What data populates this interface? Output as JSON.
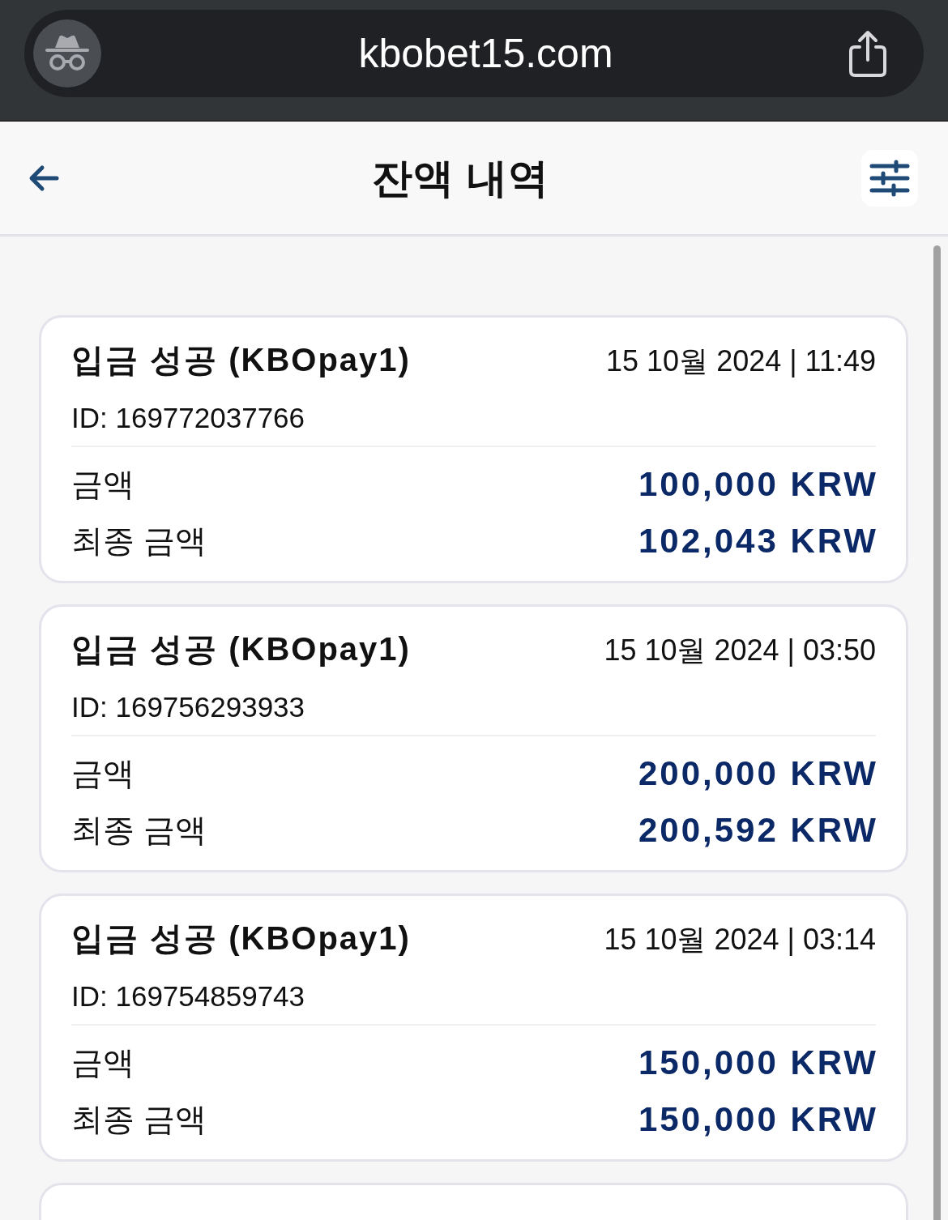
{
  "browser_bar": {
    "url": "kbobet15.com"
  },
  "header": {
    "title": "잔액 내역"
  },
  "transactions": [
    {
      "title": "입금 성공 (KBOpay1)",
      "datetime": "15 10월 2024 | 11:49",
      "id": "ID: 169772037766",
      "rows": [
        {
          "label": "금액",
          "value": "100,000 KRW"
        },
        {
          "label": "최종 금액",
          "value": "102,043 KRW"
        }
      ]
    },
    {
      "title": "입금 성공 (KBOpay1)",
      "datetime": "15 10월 2024 | 03:50",
      "id": "ID: 169756293933",
      "rows": [
        {
          "label": "금액",
          "value": "200,000 KRW"
        },
        {
          "label": "최종 금액",
          "value": "200,592 KRW"
        }
      ]
    },
    {
      "title": "입금 성공 (KBOpay1)",
      "datetime": "15 10월 2024 | 03:14",
      "id": "ID: 169754859743",
      "rows": [
        {
          "label": "금액",
          "value": "150,000 KRW"
        },
        {
          "label": "최종 금액",
          "value": "150,000 KRW"
        }
      ]
    }
  ],
  "more_below": true
}
